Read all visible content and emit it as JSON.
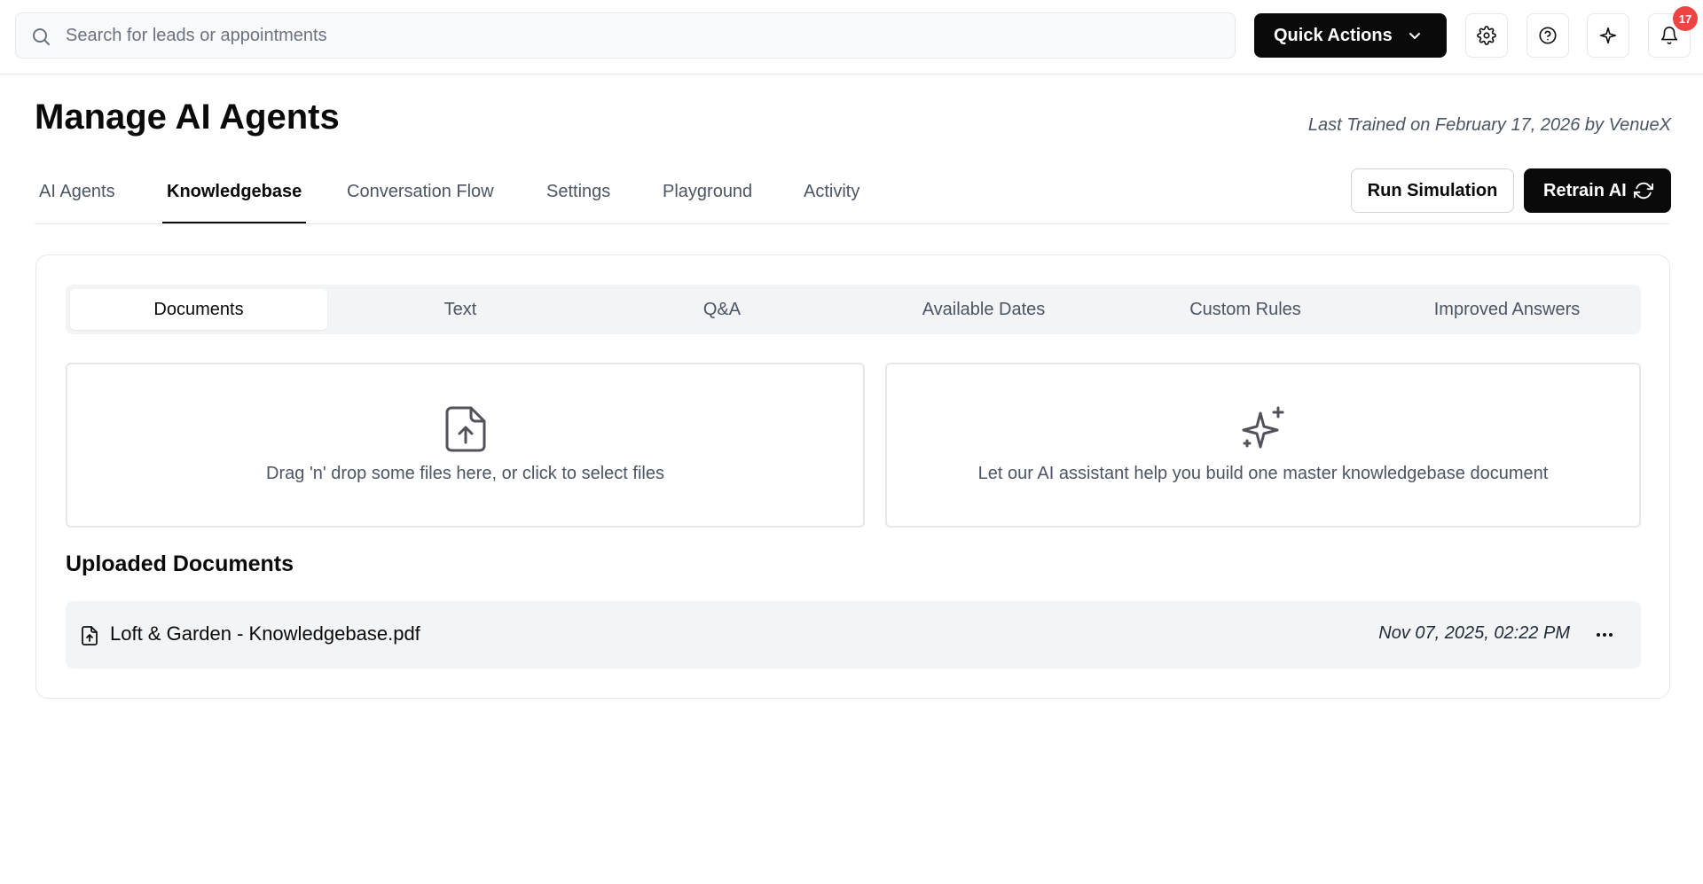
{
  "search": {
    "placeholder": "Search for leads or appointments",
    "icon": "search-icon"
  },
  "topbar": {
    "quick_actions_label": "Quick Actions",
    "icons": [
      "gear-icon",
      "help-icon",
      "sparkle-icon",
      "bell-icon"
    ],
    "notification_count": "17",
    "badge_color": "#ef4444"
  },
  "header": {
    "title": "Manage AI Agents",
    "last_trained": "Last Trained on February 17, 2026 by VenueX"
  },
  "tabs": [
    {
      "label": "AI Agents",
      "active": false
    },
    {
      "label": "Knowledgebase",
      "active": true
    },
    {
      "label": "Conversation Flow",
      "active": false
    },
    {
      "label": "Settings",
      "active": false
    },
    {
      "label": "Playground",
      "active": false
    },
    {
      "label": "Activity",
      "active": false
    }
  ],
  "actions": {
    "run_simulation": "Run Simulation",
    "retrain": "Retrain AI"
  },
  "subtabs": [
    {
      "label": "Documents",
      "active": true
    },
    {
      "label": "Text",
      "active": false
    },
    {
      "label": "Q&A",
      "active": false
    },
    {
      "label": "Available Dates",
      "active": false
    },
    {
      "label": "Custom Rules",
      "active": false
    },
    {
      "label": "Improved Answers",
      "active": false
    }
  ],
  "dropzones": {
    "upload_text": "Drag 'n' drop some files here, or click to select files",
    "ai_text": "Let our AI assistant help you build one master knowledgebase document"
  },
  "uploaded": {
    "title": "Uploaded Documents",
    "documents": [
      {
        "name": "Loft & Garden - Knowledgebase.pdf",
        "date": "Nov 07, 2025, 02:22 PM"
      }
    ]
  },
  "colors": {
    "primary": "#0a0a0a",
    "muted_text": "#4b5563",
    "border": "#e5e7eb",
    "surface": "#f3f4f6"
  }
}
